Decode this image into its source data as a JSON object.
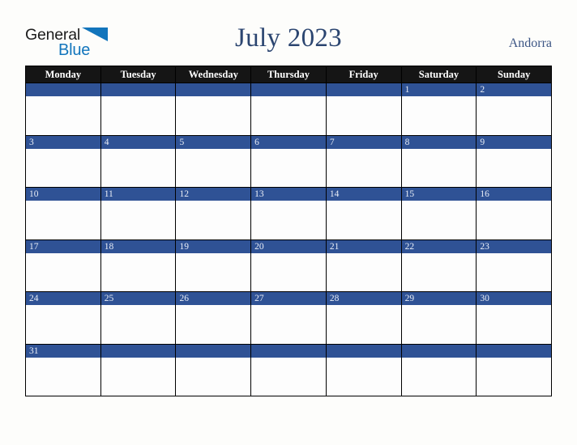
{
  "brand": {
    "name_part1": "General",
    "name_part2": "Blue",
    "color_dark": "#1c1c1c",
    "color_blue": "#1275bc"
  },
  "header": {
    "title": "July 2023",
    "region": "Andorra",
    "title_color": "#2b4570",
    "region_color": "#3c5584"
  },
  "calendar": {
    "month": "July",
    "year": "2023",
    "accent_color": "#2f5295",
    "header_background": "#151515",
    "weekdays": [
      "Monday",
      "Tuesday",
      "Wednesday",
      "Thursday",
      "Friday",
      "Saturday",
      "Sunday"
    ],
    "weeks": [
      [
        "",
        "",
        "",
        "",
        "",
        "1",
        "2"
      ],
      [
        "3",
        "4",
        "5",
        "6",
        "7",
        "8",
        "9"
      ],
      [
        "10",
        "11",
        "12",
        "13",
        "14",
        "15",
        "16"
      ],
      [
        "17",
        "18",
        "19",
        "20",
        "21",
        "22",
        "23"
      ],
      [
        "24",
        "25",
        "26",
        "27",
        "28",
        "29",
        "30"
      ],
      [
        "31",
        "",
        "",
        "",
        "",
        "",
        ""
      ]
    ]
  }
}
